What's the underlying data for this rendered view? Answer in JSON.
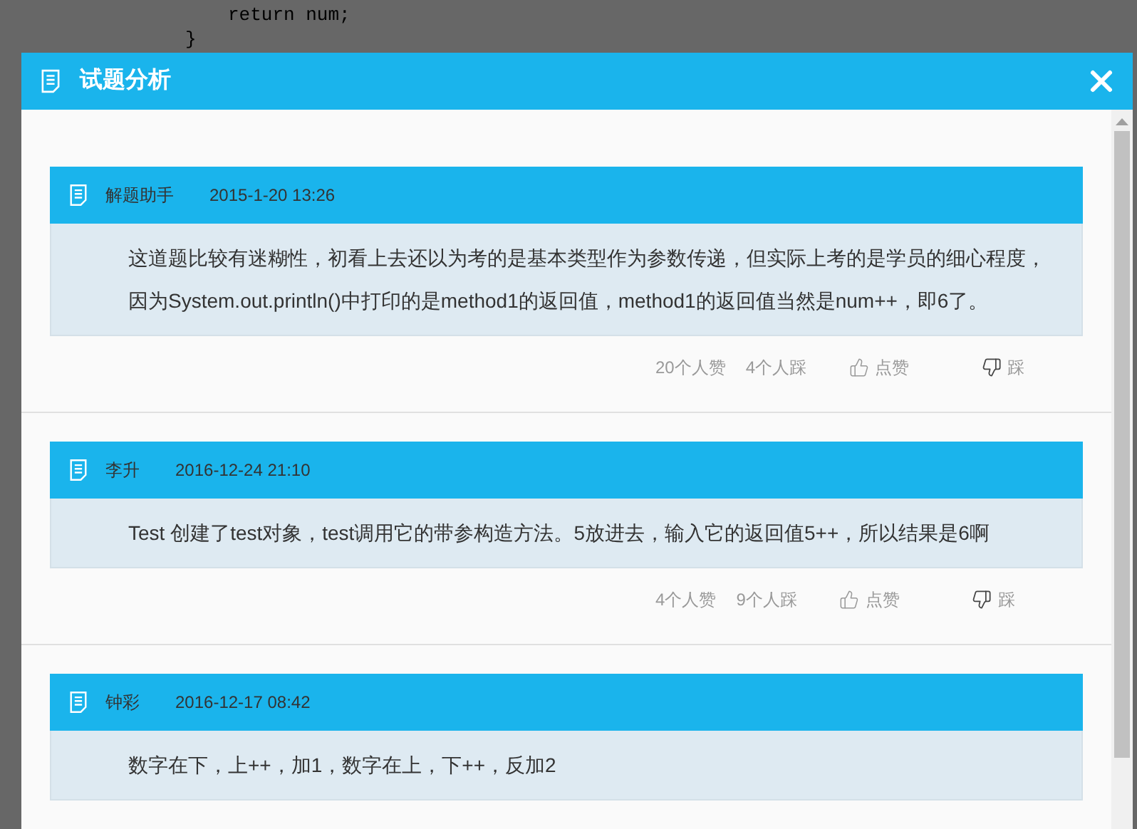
{
  "background_code": [
    "return num;",
    "}"
  ],
  "dialog": {
    "title": "试题分析"
  },
  "comments": [
    {
      "author": "解题助手",
      "time": "2015-1-20 13:26",
      "text": "这道题比较有迷糊性，初看上去还以为考的是基本类型作为参数传递，但实际上考的是学员的细心程度，因为System.out.println()中打印的是method1的返回值，method1的返回值当然是num++，即6了。",
      "likes": "20个人赞",
      "dislikes": "4个人踩",
      "like_label": "点赞",
      "dislike_label": "踩"
    },
    {
      "author": "李升",
      "time": "2016-12-24 21:10",
      "text": "Test 创建了test对象，test调用它的带参构造方法。5放进去，输入它的返回值5++，所以结果是6啊",
      "likes": "4个人赞",
      "dislikes": "9个人踩",
      "like_label": "点赞",
      "dislike_label": "踩"
    },
    {
      "author": "钟彩",
      "time": "2016-12-17 08:42",
      "text": "数字在下，上++，加1，数字在上，下++，反加2"
    }
  ]
}
